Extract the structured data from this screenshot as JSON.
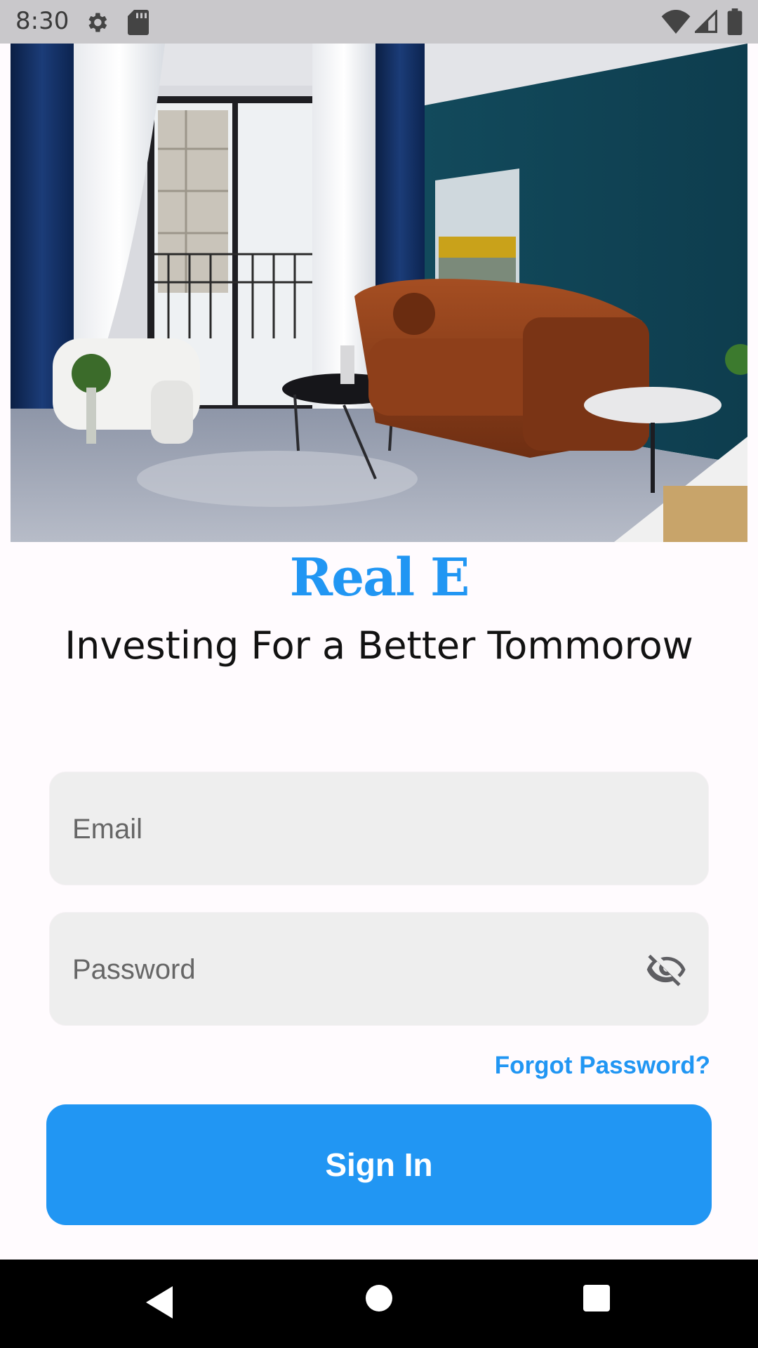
{
  "status_bar": {
    "time": "8:30",
    "icons": [
      "gear-icon",
      "sd-card-icon",
      "wifi-icon",
      "signal-icon",
      "battery-icon"
    ]
  },
  "hero": {
    "icon": "living-room-photo"
  },
  "brand": {
    "name": "Real E",
    "tagline": "Investing For a Better Tommorow",
    "accent_color": "#2196F3"
  },
  "form": {
    "email_placeholder": "Email",
    "email_value": "",
    "password_placeholder": "Password",
    "password_value": "",
    "password_toggle_icon": "eye-off-icon",
    "forgot_label": "Forgot Password?",
    "signin_label": "Sign In"
  },
  "nav_bar": {
    "icons": [
      "back-icon",
      "home-icon",
      "recents-icon"
    ]
  }
}
